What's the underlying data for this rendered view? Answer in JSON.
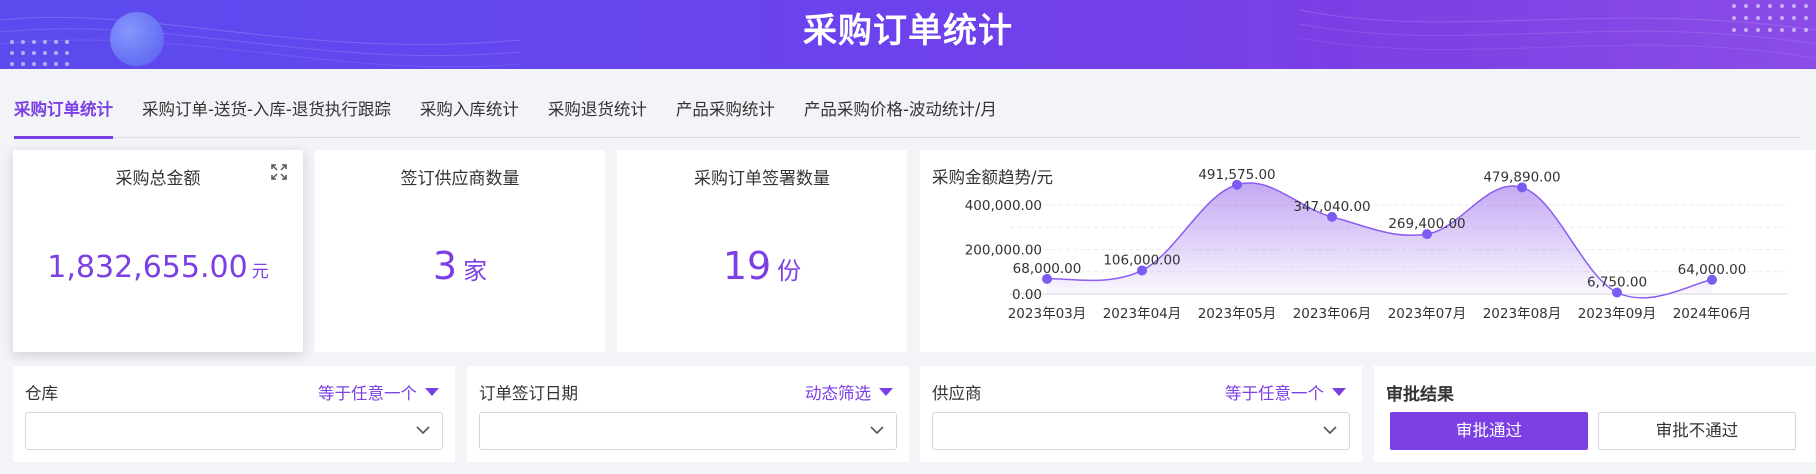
{
  "header": {
    "title": "采购订单统计"
  },
  "tabs": [
    {
      "label": "采购订单统计",
      "active": true
    },
    {
      "label": "采购订单-送货-入库-退货执行跟踪",
      "active": false
    },
    {
      "label": "采购入库统计",
      "active": false
    },
    {
      "label": "采购退货统计",
      "active": false
    },
    {
      "label": "产品采购统计",
      "active": false
    },
    {
      "label": "产品采购价格-波动统计/月",
      "active": false
    }
  ],
  "kpis": {
    "total_amount": {
      "title": "采购总金额",
      "value": "1,832,655.00",
      "unit": "元"
    },
    "suppliers": {
      "title": "签订供应商数量",
      "value": "3",
      "unit": "家"
    },
    "orders": {
      "title": "采购订单签署数量",
      "value": "19",
      "unit": "份"
    }
  },
  "chart_data": {
    "type": "area",
    "title": "采购金额趋势/元",
    "categories": [
      "2023年03月",
      "2023年04月",
      "2023年05月",
      "2023年06月",
      "2023年07月",
      "2023年08月",
      "2023年09月",
      "2024年06月"
    ],
    "values": [
      68000,
      106000,
      491575,
      347040,
      269400,
      479890,
      6750,
      64000
    ],
    "value_labels": [
      "68,000.00",
      "106,000.00",
      "491,575.00",
      "347,040.00",
      "269,400.00",
      "479,890.00",
      "6,750.00",
      "64,000.00"
    ],
    "y_ticks": [
      {
        "value": 0,
        "label": "0.00"
      },
      {
        "value": 200000,
        "label": "200,000.00"
      },
      {
        "value": 400000,
        "label": "400,000.00"
      }
    ],
    "ylim": [
      0,
      540000
    ],
    "smooth": true,
    "color": "#7b3fe4"
  },
  "filters": [
    {
      "label": "仓库",
      "mode": "等于任意一个",
      "value": ""
    },
    {
      "label": "订单签订日期",
      "mode": "动态筛选",
      "value": ""
    },
    {
      "label": "供应商",
      "mode": "等于任意一个",
      "value": ""
    }
  ],
  "approval": {
    "title": "审批结果",
    "approve_label": "审批通过",
    "reject_label": "审批不通过"
  },
  "colors": {
    "accent": "#7b3fe4",
    "banner_start": "#5b4bef",
    "banner_end": "#8a4de6"
  },
  "icons": {
    "expand": "expand-icon",
    "chevron": "chevron-down-icon",
    "caret": "caret-down-icon"
  }
}
